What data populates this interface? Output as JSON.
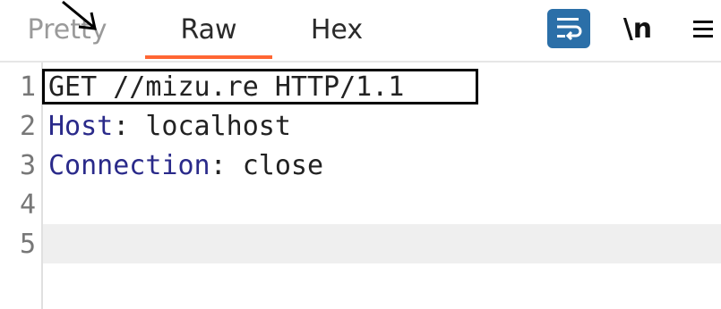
{
  "tabs": {
    "pretty": "Pretty",
    "raw": "Raw",
    "hex": "Hex"
  },
  "toolbar": {
    "newline_label": "\\n",
    "wrap_icon": "word-wrap-icon",
    "menu_icon": "hamburger-menu-icon"
  },
  "editor": {
    "lines": [
      {
        "num": "1",
        "text": "GET //mizu.re HTTP/1.1"
      },
      {
        "num": "2",
        "key": "Host",
        "sep": ": ",
        "value": "localhost"
      },
      {
        "num": "3",
        "key": "Connection",
        "sep": ": ",
        "value": "close"
      },
      {
        "num": "4",
        "text": ""
      },
      {
        "num": "5",
        "text": ""
      }
    ]
  },
  "colors": {
    "active_tab_underline": "#ff6633",
    "wrap_button_bg": "#2b6fa8",
    "header_key": "#2a2a8a"
  }
}
